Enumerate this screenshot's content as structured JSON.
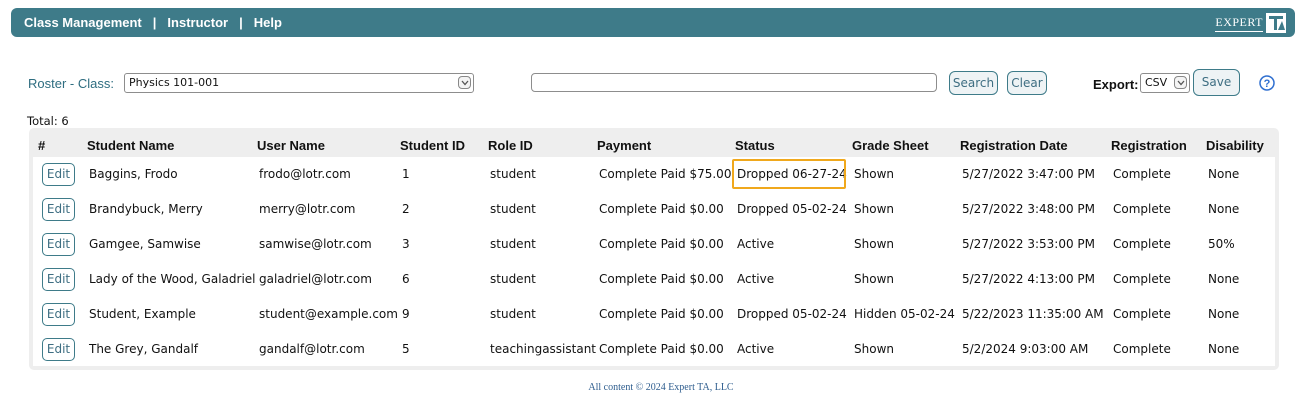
{
  "nav": {
    "items": [
      "Class Management",
      "Instructor",
      "Help"
    ],
    "separator": "|",
    "logo_text": "EXPERT"
  },
  "toolbar": {
    "roster_label": "Roster - Class:",
    "class_select_value": "Physics 101-001",
    "search_value": "",
    "search_label": "Search",
    "clear_label": "Clear",
    "export_label": "Export:",
    "export_value": "CSV",
    "save_label": "Save",
    "help_glyph": "?"
  },
  "total_label": "Total: 6",
  "table": {
    "headers": [
      "#",
      "Student Name",
      "User Name",
      "Student ID",
      "Role ID",
      "Payment",
      "Status",
      "Grade Sheet",
      "Registration Date",
      "Registration",
      "Disability"
    ],
    "edit_label": "Edit",
    "rows": [
      {
        "name": "Baggins, Frodo",
        "user": "frodo@lotr.com",
        "id": "1",
        "role": "student",
        "payment": "Complete Paid $75.00",
        "status": "Dropped 06-27-24",
        "grade": "Shown",
        "date": "5/27/2022 3:47:00 PM",
        "reg": "Complete",
        "disability": "None"
      },
      {
        "name": "Brandybuck, Merry",
        "user": "merry@lotr.com",
        "id": "2",
        "role": "student",
        "payment": "Complete Paid $0.00",
        "status": "Dropped 05-02-24",
        "grade": "Shown",
        "date": "5/27/2022 3:48:00 PM",
        "reg": "Complete",
        "disability": "None"
      },
      {
        "name": "Gamgee, Samwise",
        "user": "samwise@lotr.com",
        "id": "3",
        "role": "student",
        "payment": "Complete Paid $0.00",
        "status": "Active",
        "grade": "Shown",
        "date": "5/27/2022 3:53:00 PM",
        "reg": "Complete",
        "disability": "50%"
      },
      {
        "name": "Lady of the Wood, Galadriel",
        "user": "galadriel@lotr.com",
        "id": "6",
        "role": "student",
        "payment": "Complete Paid $0.00",
        "status": "Active",
        "grade": "Shown",
        "date": "5/27/2022 4:13:00 PM",
        "reg": "Complete",
        "disability": "None"
      },
      {
        "name": "Student, Example",
        "user": "student@example.com",
        "id": "9",
        "role": "student",
        "payment": "Complete Paid $0.00",
        "status": "Dropped 05-02-24",
        "grade": "Hidden 05-02-24",
        "date": "5/22/2023 11:35:00 AM",
        "reg": "Complete",
        "disability": "None"
      },
      {
        "name": "The Grey, Gandalf",
        "user": "gandalf@lotr.com",
        "id": "5",
        "role": "teachingassistant",
        "payment": "Complete Paid $0.00",
        "status": "Active",
        "grade": "Shown",
        "date": "5/2/2024 9:03:00 AM",
        "reg": "Complete",
        "disability": "None"
      }
    ]
  },
  "footer": "All content © 2024 Expert TA, LLC",
  "colors": {
    "brand": "#3e7b89",
    "highlight": "#f0a81c",
    "label_blue": "#2e6d80"
  }
}
